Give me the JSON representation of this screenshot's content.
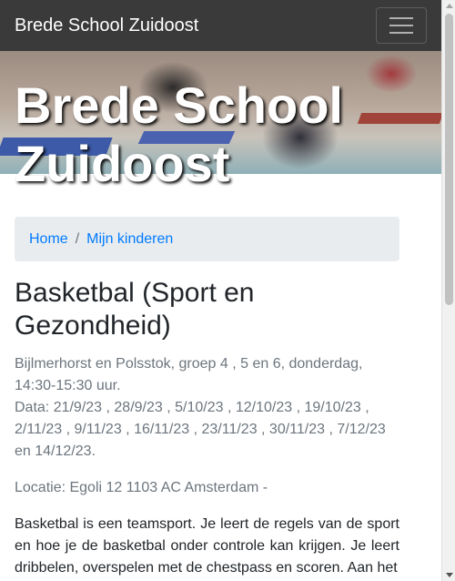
{
  "navbar": {
    "brand": "Brede School Zuidoost",
    "menu_icon": "hamburger-menu-icon"
  },
  "hero": {
    "title": "Brede School Zuidoost"
  },
  "breadcrumb": {
    "items": [
      "Home",
      "Mijn kinderen"
    ],
    "separator": "/"
  },
  "course": {
    "title": "Basketbal (Sport en Gezondheid)",
    "info_lines": [
      "Bijlmerhorst en Polsstok, groep 4 , 5 en 6, donderdag, 14:30-15:30 uur.",
      "Data: 21/9/23 , 28/9/23 , 5/10/23 , 12/10/23 , 19/10/23 , 2/11/23 , 9/11/23 , 16/11/23 , 23/11/23 , 30/11/23 , 7/12/23 en 14/12/23."
    ],
    "location": "Locatie: Egoli 12 1103 AC Amsterdam -",
    "description": "Basketbal is een teamsport. Je leert de regels van de sport en hoe je de basketbal onder controle kan krijgen. Je leert dribbelen, overspelen met de chestpass en scoren. Aan het"
  },
  "colors": {
    "navbar_bg": "#3a3a3a",
    "link": "#007bff",
    "breadcrumb_bg": "#e9ecef",
    "muted_text": "#6c757d"
  }
}
